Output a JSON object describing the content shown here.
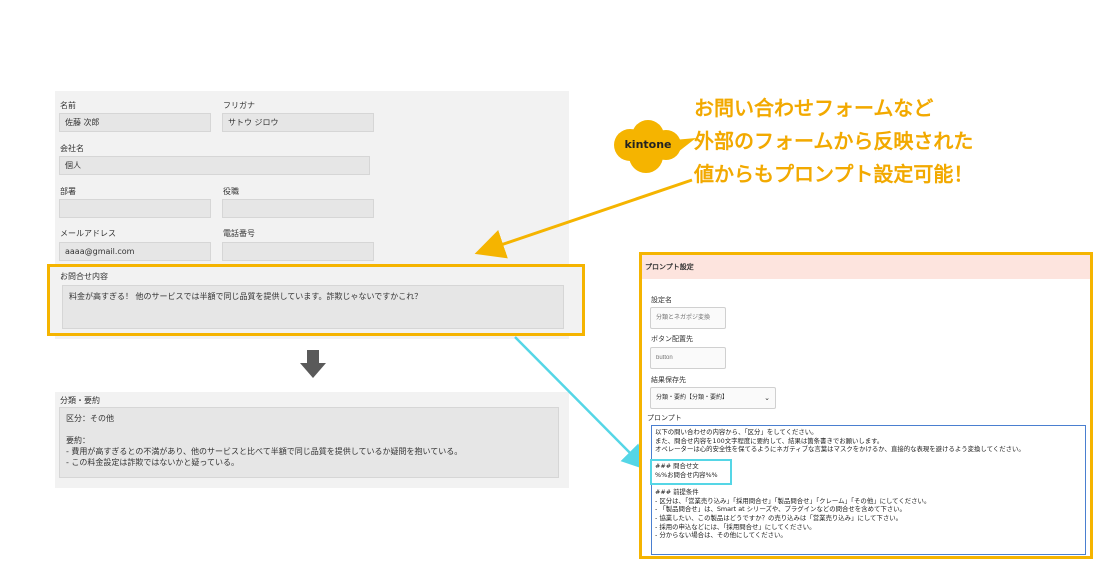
{
  "form": {
    "name_label": "名前",
    "name_value": "佐藤 次郎",
    "furigana_label": "フリガナ",
    "furigana_value": "サトウ ジロウ",
    "company_label": "会社名",
    "company_value": "個人",
    "dept_label": "部署",
    "dept_value": "",
    "title_label": "役職",
    "title_value": "",
    "email_label": "メールアドレス",
    "email_value": "aaaa@gmail.com",
    "phone_label": "電話番号",
    "phone_value": "",
    "inquiry_label": "お問合せ内容",
    "inquiry_value": "料金が高すぎる！ 他のサービスでは半額で同じ品質を提供しています。詐欺じゃないですかこれ？"
  },
  "summary": {
    "label": "分類・要約",
    "category": "区分：その他",
    "summary_heading": "要約：",
    "line1": "- 費用が高すぎるとの不満があり、他のサービスと比べて半額で同じ品質を提供しているか疑問を抱いている。",
    "line2": "- この料金設定は詐欺ではないかと疑っている。"
  },
  "callout": {
    "badge": "kintone",
    "line1": "お問い合わせフォームなど",
    "line2": "外部のフォームから反映された",
    "line3": "値からもプロンプト設定可能！",
    "color": "#f2a900"
  },
  "prompt_panel": {
    "header": "プロンプト設定",
    "setting_name_label": "設定名",
    "setting_name_placeholder": "分類とネガポジ変換",
    "button_location_label": "ボタン配置先",
    "button_location_placeholder": "button",
    "result_field_label": "結果保存先",
    "result_field_value": "分類・要約【分類・要約】",
    "prompt_label": "プロンプト",
    "prompt_text": "以下の問い合わせの内容から、「区分」をしてください。\nまた、問合せ内容を100文字程度に要約して、結果は箇条書きでお願いします。\nオペレーターは心的安全性を保てるようにネガティブな言葉はマスクをかけるか、直接的な表現を避けるよう変換してください。\n\n### 問合せ文\n%%お問合せ内容%%\n\n### 前提条件\n- 区分は、「営業売り込み」「採用問合せ」「製品問合せ」「クレーム」「その他」にしてください。\n- 「製品問合せ」は、Smart at シリーズや、プラグインなどの問合せを含めて下さい。\n- 協業したい、この製品はどうですか？の売り込みは「営業売り込み」にして下さい。\n- 採用の申込などには、「採用問合せ」にしてください。\n- 分からない場合は、その他にしてください。"
  },
  "colors": {
    "highlight_border": "#f5b400",
    "connector": "#55d6e6",
    "header_bg": "#fde4de"
  }
}
